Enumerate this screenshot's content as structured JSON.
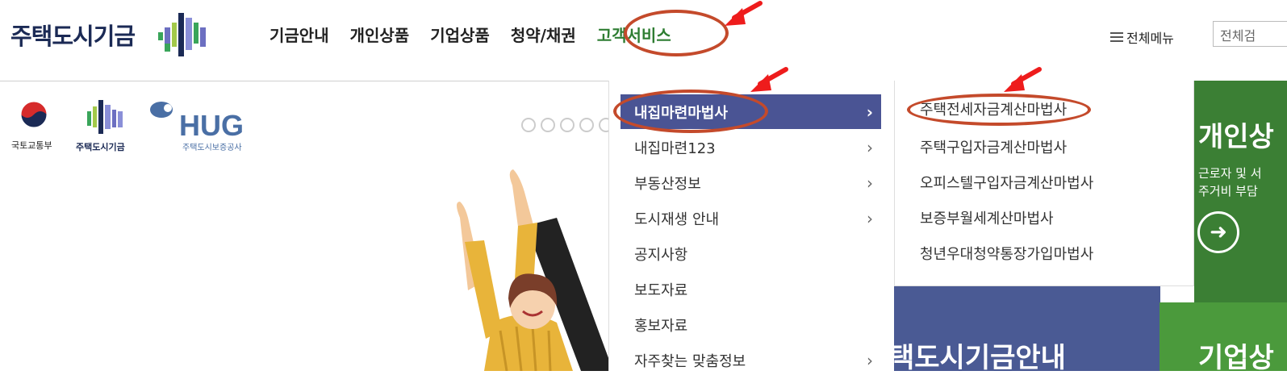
{
  "header": {
    "logo_text": "주택도시기금",
    "nav": [
      "기금안내",
      "개인상품",
      "기업상품",
      "청약/채권",
      "고객서비스"
    ],
    "all_menu": "전체메뉴",
    "search_placeholder": "전체검"
  },
  "gov_logos": {
    "molit": "국토교통부",
    "fund": "주택도시기금",
    "hug": "HUG",
    "hug_sub": "주택도시보증공사"
  },
  "dropdown_level1": [
    {
      "label": "내집마련마법사",
      "selected": true
    },
    {
      "label": "내집마련123"
    },
    {
      "label": "부동산정보"
    },
    {
      "label": "도시재생 안내"
    },
    {
      "label": "공지사항"
    },
    {
      "label": "보도자료"
    },
    {
      "label": "홍보자료"
    },
    {
      "label": "자주찾는 맞춤정보"
    }
  ],
  "dropdown_level2": [
    "주택전세자금계산마법사",
    "주택구입자금계산마법사",
    "오피스텔구입자금계산마법사",
    "보증부월세계산마법사",
    "청년우대청약통장가입마법사"
  ],
  "panels": {
    "personal_title": "개인상",
    "personal_desc1": "근로자 및 서",
    "personal_desc2": "주거비 부담",
    "fund_info": "택도시기금안내",
    "corporate_title": "기업상"
  },
  "colors": {
    "brand_navy": "#1b2a55",
    "menu_selected": "#4a5494",
    "annotation_red": "#c44a2b",
    "green_panel": "#3b7f34"
  }
}
